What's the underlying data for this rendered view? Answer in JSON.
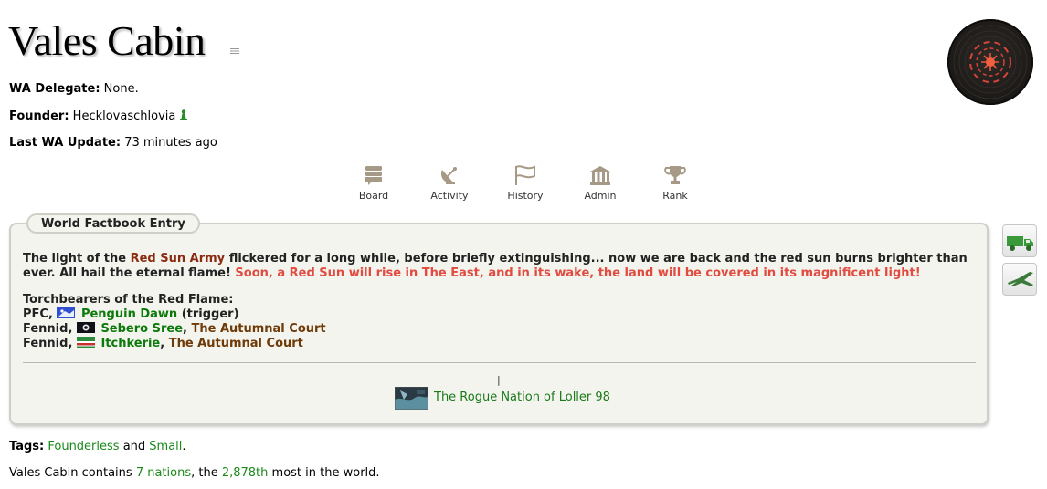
{
  "region": {
    "name": "Vales Cabin"
  },
  "meta": {
    "delegate_label": "WA Delegate:",
    "delegate_value": "None.",
    "founder_label": "Founder:",
    "founder_value": "Hecklovaschlovia",
    "update_label": "Last WA Update:",
    "update_value": "73 minutes ago"
  },
  "nav": {
    "board": "Board",
    "activity": "Activity",
    "history": "History",
    "admin": "Admin",
    "rank": "Rank"
  },
  "factbook": {
    "tab_label": "World Factbook Entry",
    "p1_a": "The light of the ",
    "p1_army": "Red Sun Army",
    "p1_b": " flickered for a long while, before briefly extinguishing... now we are back and the red sun burns brighter than",
    "p1_c": "ever. All hail the eternal flame! ",
    "p1_red": "Soon, a Red Sun will rise in The East, and in its wake, the land will be covered in its magnificent light!",
    "torch_title": "Torchbearers of the Red Flame:",
    "rows": [
      {
        "prefix": "PFC, ",
        "name": "Penguin Dawn",
        "suffix": " (trigger)",
        "court": ""
      },
      {
        "prefix": "Fennid, ",
        "name": "Sebero Sree",
        "suffix": ", ",
        "court": "The Autumnal Court"
      },
      {
        "prefix": "Fennid, ",
        "name": "Itchkerie",
        "suffix": ", ",
        "court": "The Autumnal Court"
      }
    ],
    "mark": "|",
    "rogue_nation": "The Rogue Nation of Loller 98"
  },
  "footer": {
    "tags_label": "Tags:",
    "tag1": "Founderless",
    "and": " and ",
    "tag2": "Small",
    "period": ".",
    "contains_a": "Vales Cabin contains ",
    "nations": "7 nations",
    "contains_b": ", the ",
    "rank": "2,878th",
    "contains_c": " most in the world."
  },
  "colors": {
    "accent_green": "#1a8a1a",
    "dark_red": "#8b2c10",
    "bright_red": "#e14b40",
    "box_bg": "#f4f4ee"
  }
}
